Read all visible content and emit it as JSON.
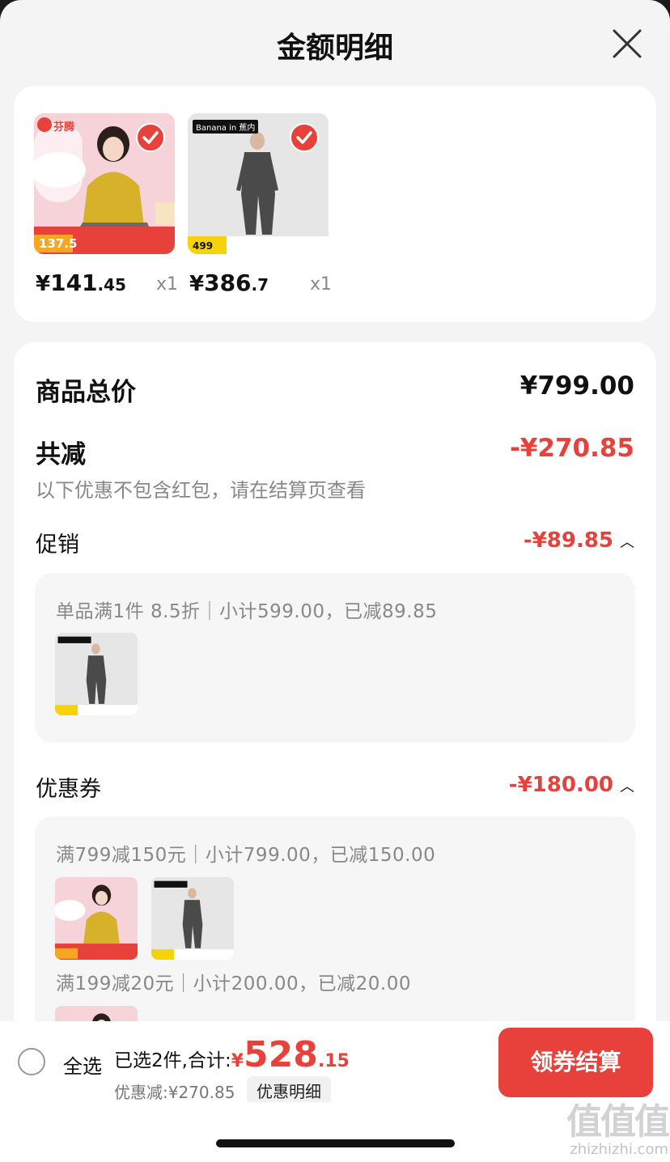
{
  "header": {
    "title": "金额明细"
  },
  "products": [
    {
      "brand": "芬腾",
      "promo_price": "137.5",
      "price_currency": "¥",
      "price_int": "141",
      "price_dec": ".45",
      "qty": "x1"
    },
    {
      "brand": "Banana",
      "brand_tag": "in",
      "brand_tag2": "蕉内",
      "promo_price": "499",
      "price_currency": "¥",
      "price_int": "386",
      "price_dec": ".7",
      "qty": "x1"
    }
  ],
  "summary": {
    "total_label": "商品总价",
    "total_value": "¥799.00",
    "reduce_label": "共减",
    "reduce_value": "-¥270.85",
    "reduce_note": "以下优惠不包含红包，请在结算页查看"
  },
  "promotion": {
    "label": "促销",
    "value": "-¥89.85",
    "rule": "单品满1件 8.5折｜小计599.00，已减89.85"
  },
  "coupon": {
    "label": "优惠券",
    "value": "-¥180.00",
    "rules": [
      "满799减150元｜小计799.00，已减150.00",
      "满199减20元｜小计200.00，已减20.00"
    ]
  },
  "bottom_bar": {
    "select_all": "全选",
    "selected_text": "已选2件,合计:",
    "total_currency": "¥",
    "total_int": "528",
    "total_dec": ".15",
    "saved_text": "优惠减:¥270.85",
    "detail_link": "优惠明细",
    "checkout": "领券结算"
  },
  "watermark": {
    "big": "值值值",
    "small": "zhizhizhi.com"
  },
  "colors": {
    "accent": "#e8413b",
    "background": "#f4f4f4",
    "card": "#ffffff"
  }
}
